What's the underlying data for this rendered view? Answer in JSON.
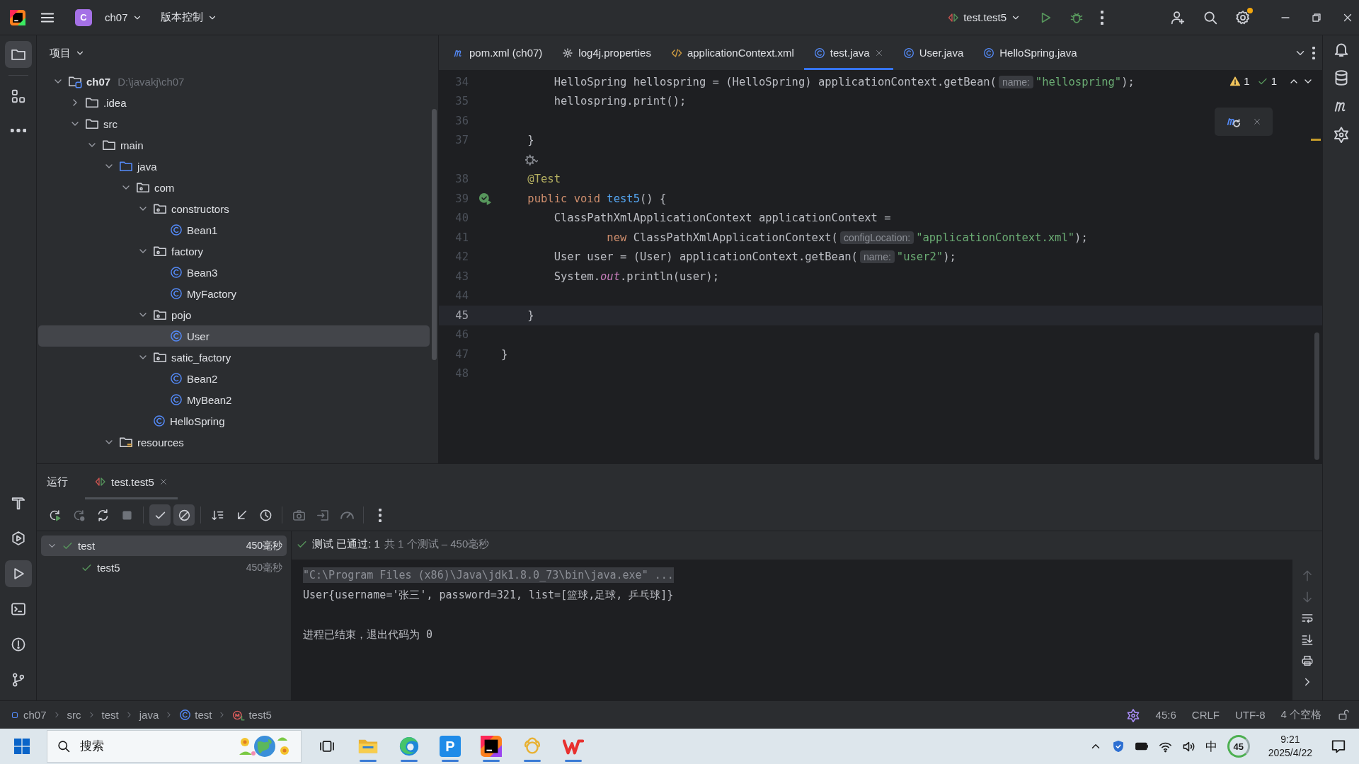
{
  "title_bar": {
    "project_badge": "C",
    "project": "ch07",
    "vcs_menu": "版本控制",
    "run_config": "test.test5",
    "settings_badge": true
  },
  "left_toolbar": {
    "top": [
      {
        "kind": "project",
        "selected": true
      },
      {
        "kind": "structure",
        "selected": false
      },
      {
        "kind": "more",
        "selected": false
      }
    ],
    "bottom": [
      {
        "kind": "build",
        "selected": false
      },
      {
        "kind": "services",
        "selected": false
      },
      {
        "kind": "run",
        "selected": true
      },
      {
        "kind": "terminal",
        "selected": false
      },
      {
        "kind": "problems",
        "selected": false
      },
      {
        "kind": "git",
        "selected": false
      }
    ]
  },
  "project": {
    "title": "项目",
    "tree": [
      {
        "label": "ch07",
        "kind": "project",
        "path": "D:\\javakj\\ch07",
        "expanded": true,
        "selected": false,
        "children": [
          {
            "label": ".idea",
            "kind": "folder",
            "expanded": false,
            "selected": false
          },
          {
            "label": "src",
            "kind": "folder",
            "expanded": true,
            "selected": false,
            "children": [
              {
                "label": "main",
                "kind": "folder",
                "expanded": true,
                "selected": false,
                "children": [
                  {
                    "label": "java",
                    "kind": "source",
                    "expanded": true,
                    "selected": false,
                    "children": [
                      {
                        "label": "com",
                        "kind": "package",
                        "expanded": true,
                        "selected": false,
                        "children": [
                          {
                            "label": "constructors",
                            "kind": "package",
                            "expanded": true,
                            "selected": false,
                            "children": [
                              {
                                "label": "Bean1",
                                "kind": "class",
                                "selected": false
                              }
                            ]
                          },
                          {
                            "label": "factory",
                            "kind": "package",
                            "expanded": true,
                            "selected": false,
                            "children": [
                              {
                                "label": "Bean3",
                                "kind": "class",
                                "selected": false
                              },
                              {
                                "label": "MyFactory",
                                "kind": "class",
                                "selected": false
                              }
                            ]
                          },
                          {
                            "label": "pojo",
                            "kind": "package",
                            "expanded": true,
                            "selected": false,
                            "children": [
                              {
                                "label": "User",
                                "kind": "class",
                                "selected": true
                              }
                            ]
                          },
                          {
                            "label": "satic_factory",
                            "kind": "package",
                            "expanded": true,
                            "selected": false,
                            "children": [
                              {
                                "label": "Bean2",
                                "kind": "class",
                                "selected": false
                              },
                              {
                                "label": "MyBean2",
                                "kind": "class",
                                "selected": false
                              }
                            ]
                          },
                          {
                            "label": "HelloSpring",
                            "kind": "class",
                            "selected": false
                          }
                        ]
                      }
                    ]
                  },
                  {
                    "label": "resources",
                    "kind": "resources",
                    "expanded": true,
                    "selected": false
                  }
                ]
              }
            ]
          }
        ]
      }
    ]
  },
  "editor": {
    "tabs": [
      {
        "label": "pom.xml (ch07)",
        "kind": "maven",
        "selected": false
      },
      {
        "label": "log4j.properties",
        "kind": "properties",
        "selected": false
      },
      {
        "label": "applicationContext.xml",
        "kind": "xml",
        "selected": false
      },
      {
        "label": "test.java",
        "kind": "class",
        "selected": true
      },
      {
        "label": "User.java",
        "kind": "class",
        "selected": false
      },
      {
        "label": "HelloSpring.java",
        "kind": "class",
        "selected": false
      }
    ],
    "inspections": {
      "warnings": "1",
      "checks": "1"
    },
    "popup": {
      "kind": "maven-reload"
    },
    "lines": [
      {
        "kind": "code",
        "number": "34",
        "current": false,
        "run_marker": false,
        "segments": [
          {
            "t": "        HelloSpring hellospring = (HelloSpring) applicationContext.getBean(",
            "kind": "plain"
          },
          {
            "t": "name:",
            "kind": "hint"
          },
          {
            "t": "\"hellospring\"",
            "kind": "str"
          },
          {
            "t": ");",
            "kind": "plain"
          }
        ]
      },
      {
        "kind": "code",
        "number": "35",
        "current": false,
        "run_marker": false,
        "segments": [
          {
            "t": "        hellospring.print();",
            "kind": "plain"
          }
        ]
      },
      {
        "kind": "code",
        "number": "36",
        "current": false,
        "run_marker": false
      },
      {
        "kind": "code",
        "number": "37",
        "current": false,
        "run_marker": false,
        "segments": [
          {
            "t": "    }",
            "kind": "plain"
          }
        ]
      },
      {
        "kind": "vision"
      },
      {
        "kind": "code",
        "number": "38",
        "current": false,
        "run_marker": false,
        "segments": [
          {
            "t": "    @Test",
            "kind": "ann"
          }
        ]
      },
      {
        "kind": "code",
        "number": "39",
        "current": false,
        "run_marker": true,
        "segments": [
          {
            "t": "    public void ",
            "kind": "kw"
          },
          {
            "t": "test5",
            "kind": "method"
          },
          {
            "t": "() {",
            "kind": "plain"
          }
        ]
      },
      {
        "kind": "code",
        "number": "40",
        "current": false,
        "run_marker": false,
        "segments": [
          {
            "t": "        ClassPathXmlApplicationContext applicationContext =",
            "kind": "plain"
          }
        ]
      },
      {
        "kind": "code",
        "number": "41",
        "current": false,
        "run_marker": false,
        "segments": [
          {
            "t": "                new ",
            "kind": "kw"
          },
          {
            "t": "ClassPathXmlApplicationContext(",
            "kind": "plain"
          },
          {
            "t": "configLocation:",
            "kind": "hint"
          },
          {
            "t": "\"applicationContext.xml\"",
            "kind": "str"
          },
          {
            "t": ");",
            "kind": "plain"
          }
        ]
      },
      {
        "kind": "code",
        "number": "42",
        "current": false,
        "run_marker": false,
        "segments": [
          {
            "t": "        User user = (User) applicationContext.getBean(",
            "kind": "plain"
          },
          {
            "t": "name:",
            "kind": "hint"
          },
          {
            "t": "\"user2\"",
            "kind": "str"
          },
          {
            "t": ");",
            "kind": "plain"
          }
        ]
      },
      {
        "kind": "code",
        "number": "43",
        "current": false,
        "run_marker": false,
        "segments": [
          {
            "t": "        System.",
            "kind": "plain"
          },
          {
            "t": "out",
            "kind": "static"
          },
          {
            "t": ".println(user);",
            "kind": "plain"
          }
        ]
      },
      {
        "kind": "code",
        "number": "44",
        "current": false,
        "run_marker": false
      },
      {
        "kind": "code",
        "number": "45",
        "current": true,
        "run_marker": false,
        "segments": [
          {
            "t": "    }",
            "kind": "plain"
          }
        ]
      },
      {
        "kind": "code",
        "number": "46",
        "current": false,
        "run_marker": false
      },
      {
        "kind": "code",
        "number": "47",
        "current": false,
        "run_marker": false,
        "segments": [
          {
            "t": "}",
            "kind": "plain"
          }
        ]
      },
      {
        "kind": "code",
        "number": "48",
        "current": false,
        "run_marker": false
      }
    ]
  },
  "right_toolbar": [
    {
      "kind": "notifications"
    },
    {
      "kind": "database"
    },
    {
      "kind": "maven"
    },
    {
      "kind": "assistant"
    }
  ],
  "run_panel": {
    "title": "运行",
    "tabs": [
      {
        "label": "test.test5",
        "selected": true
      }
    ],
    "toolbar": [
      {
        "kind": "rerun",
        "disabled": false,
        "on": false
      },
      {
        "kind": "rerun-failed",
        "disabled": true,
        "on": false
      },
      {
        "kind": "toggle-auto",
        "disabled": false,
        "on": false
      },
      {
        "kind": "stop",
        "disabled": true,
        "on": false
      },
      {
        "kind": "show-passed",
        "disabled": false,
        "on": true
      },
      {
        "kind": "show-ignored",
        "disabled": false,
        "on": true
      },
      {
        "kind": "sort",
        "disabled": false,
        "on": false
      },
      {
        "kind": "collapse",
        "disabled": false,
        "on": false
      },
      {
        "kind": "history",
        "disabled": false,
        "on": false
      },
      {
        "kind": "screenshot",
        "disabled": true,
        "on": false
      },
      {
        "kind": "import",
        "disabled": true,
        "on": false
      },
      {
        "kind": "coverage",
        "disabled": true,
        "on": false
      },
      {
        "kind": "more",
        "disabled": false,
        "on": false
      }
    ],
    "tests": [
      {
        "name": "test",
        "time": "450毫秒",
        "passed": true,
        "selected": true,
        "expanded": true,
        "children": [
          {
            "name": "test5",
            "time": "450毫秒",
            "passed": true,
            "selected": false
          }
        ]
      }
    ],
    "summary": {
      "passed": true,
      "status": "测试 已通过: 1",
      "detail": "共 1 个测试 – 450毫秒"
    },
    "console": [
      {
        "kind": "command",
        "text": "\"C:\\Program Files (x86)\\Java\\jdk1.8.0_73\\bin\\java.exe\" ..."
      },
      {
        "kind": "output",
        "text": "User{username='张三', password=321, list=[篮球,足球, 乒乓球]}"
      },
      {
        "kind": "blank"
      },
      {
        "kind": "output",
        "text": "进程已结束，退出代码为 0"
      }
    ],
    "console_toolbar": [
      {
        "kind": "up",
        "disabled": true
      },
      {
        "kind": "down",
        "disabled": true
      },
      {
        "kind": "wrap",
        "disabled": false
      },
      {
        "kind": "scroll-end",
        "disabled": false
      },
      {
        "kind": "print",
        "disabled": false
      },
      {
        "kind": "expand",
        "disabled": false
      }
    ]
  },
  "status_bar": {
    "breadcrumbs": [
      {
        "label": "ch07",
        "kind": "module"
      },
      {
        "label": "src",
        "kind": "folder"
      },
      {
        "label": "test",
        "kind": "folder"
      },
      {
        "label": "java",
        "kind": "folder"
      },
      {
        "label": "test",
        "kind": "class"
      },
      {
        "label": "test5",
        "kind": "method"
      }
    ],
    "position": "45:6",
    "line_separator": "CRLF",
    "encoding": "UTF-8",
    "indent": "4 个空格"
  },
  "taskbar": {
    "search": {
      "placeholder": "搜索"
    },
    "apps": [
      {
        "kind": "task-view",
        "running": false
      },
      {
        "kind": "explorer",
        "running": true
      },
      {
        "kind": "edge",
        "running": true
      },
      {
        "kind": "letter-app",
        "label": "P",
        "running": true
      },
      {
        "kind": "ide",
        "running": true
      },
      {
        "kind": "flower-app",
        "running": true
      },
      {
        "kind": "wps",
        "running": true
      }
    ],
    "tray": {
      "ime": "中",
      "meter": "45",
      "time": "9:21",
      "date": "2025/4/22"
    }
  }
}
